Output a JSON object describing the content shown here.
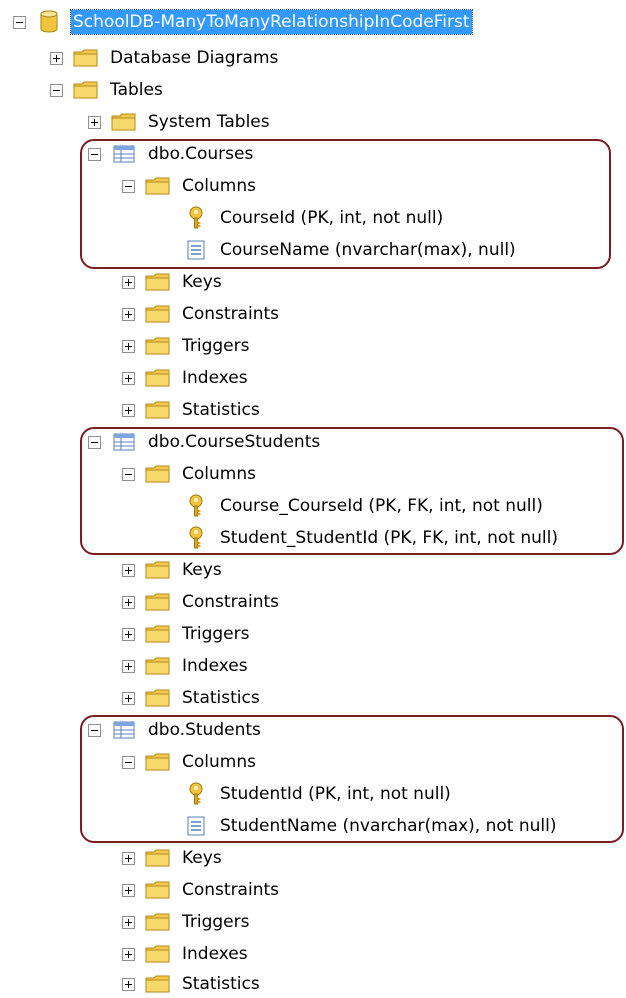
{
  "tree": {
    "root": {
      "label": "SchoolDB-ManyToManyRelationshipInCodeFirst",
      "icon": "database-icon"
    },
    "database_diagrams": "Database Diagrams",
    "tables": "Tables",
    "system_tables": "System Tables",
    "courses": {
      "name": "dbo.Courses",
      "columns_label": "Columns",
      "columns": [
        {
          "icon": "primary-key-icon",
          "text": "CourseId (PK, int, not null)"
        },
        {
          "icon": "column-icon",
          "text": "CourseName (nvarchar(max), null)"
        }
      ],
      "folders": [
        "Keys",
        "Constraints",
        "Triggers",
        "Indexes",
        "Statistics"
      ]
    },
    "course_students": {
      "name": "dbo.CourseStudents",
      "columns_label": "Columns",
      "columns": [
        {
          "icon": "primary-key-icon",
          "text": "Course_CourseId (PK, FK, int, not null)"
        },
        {
          "icon": "primary-key-icon",
          "text": "Student_StudentId (PK, FK, int, not null)"
        }
      ],
      "folders": [
        "Keys",
        "Constraints",
        "Triggers",
        "Indexes",
        "Statistics"
      ]
    },
    "students": {
      "name": "dbo.Students",
      "columns_label": "Columns",
      "columns": [
        {
          "icon": "primary-key-icon",
          "text": "StudentId (PK, int, not null)"
        },
        {
          "icon": "column-icon",
          "text": "StudentName (nvarchar(max), not null)"
        }
      ],
      "folders": [
        "Keys",
        "Constraints",
        "Triggers",
        "Indexes",
        "Statistics"
      ]
    }
  },
  "colors": {
    "selection": "#3399ff",
    "highlight_border": "#7a1d22",
    "folder": "#f3c94e"
  }
}
